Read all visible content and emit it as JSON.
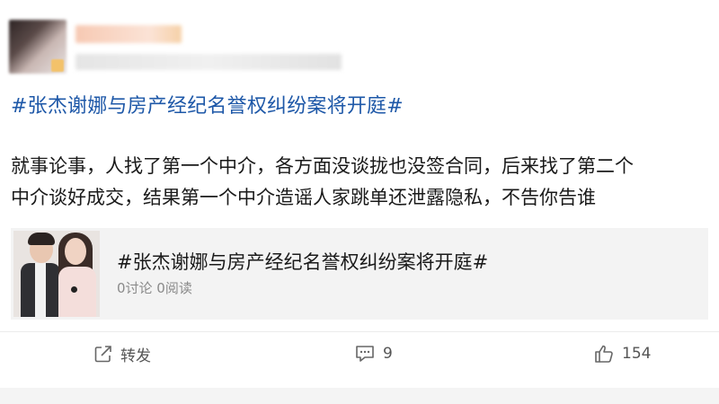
{
  "post": {
    "hashtag_title": "#张杰谢娜与房产经纪名誉权纠纷案将开庭#",
    "body_lines": [
      "就事论事，人找了第一个中介，各方面没谈拢也没签合同，后来找了第二个",
      "中介谈好成交，结果第一个中介造谣人家跳单还泄露隐私，不告你告谁"
    ]
  },
  "link_card": {
    "title": "#张杰谢娜与房产经纪名誉权纠纷案将开庭#",
    "stats": "0讨论 0阅读"
  },
  "actions": {
    "share_label": "转发",
    "share_icon": "share-icon",
    "comment_count": "9",
    "comment_icon": "comment-icon",
    "like_count": "154",
    "like_icon": "thumbs-up-icon"
  },
  "colors": {
    "hashtag": "#1e58a8",
    "body_text": "#1a1a1a",
    "meta_text": "#8a8a8a",
    "action_text": "#555555"
  }
}
